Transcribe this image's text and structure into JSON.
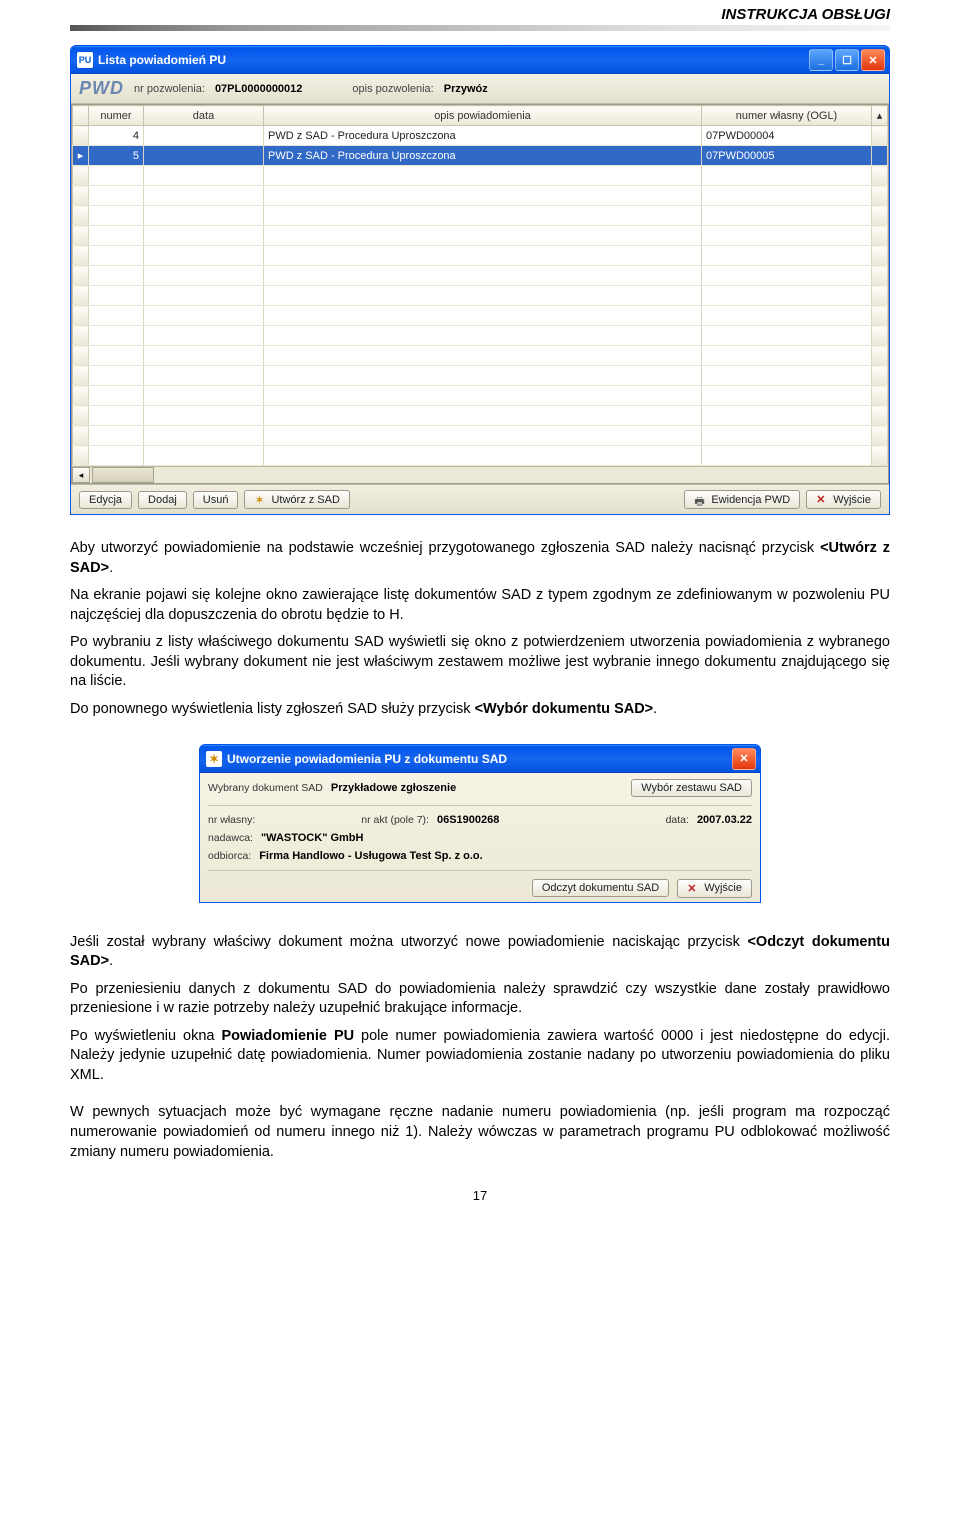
{
  "header": {
    "title": "INSTRUKCJA OBSŁUGI"
  },
  "window1": {
    "icon_label": "PU",
    "title": "Lista powiadomień PU",
    "pwd_label": "PWD",
    "nr_label": "nr pozwolenia:",
    "nr_value": "07PL0000000012",
    "opis_label": "opis pozwolenia:",
    "opis_value": "Przywóz",
    "cols": {
      "numer": "numer",
      "data": "data",
      "opis": "opis powiadomienia",
      "wlasny": "numer własny (OGL)"
    },
    "rows": [
      {
        "numer": "4",
        "data": "",
        "opis": "PWD z SAD - Procedura Uproszczona",
        "wlasny": "07PWD00004",
        "selected": false
      },
      {
        "numer": "5",
        "data": "",
        "opis": "PWD z SAD - Procedura Uproszczona",
        "wlasny": "07PWD00005",
        "selected": true
      }
    ],
    "buttons": {
      "edycja": "Edycja",
      "dodaj": "Dodaj",
      "usun": "Usuń",
      "utworz": "Utwórz z SAD",
      "ewid": "Ewidencja PWD",
      "wyjscie": "Wyjście"
    }
  },
  "para1_a": "Aby utworzyć powiadomienie na podstawie wcześniej przygotowanego zgłoszenia SAD należy nacisnąć przycisk ",
  "para1_b": "<Utwórz z SAD>",
  "para1_c": ".",
  "para2": "Na ekranie pojawi się kolejne okno zawierające listę dokumentów SAD z typem zgodnym ze zdefiniowanym w pozwoleniu PU najczęściej dla dopuszczenia do obrotu będzie to H.",
  "para3": "Po wybraniu z listy właściwego dokumentu SAD wyświetli się okno z potwierdzeniem utworzenia powiadomienia z wybranego dokumentu. Jeśli wybrany dokument nie jest właściwym zestawem możliwe jest wybranie innego dokumentu znajdującego się na liście.",
  "para4_a": "Do ponownego wyświetlenia listy zgłoszeń SAD służy przycisk ",
  "para4_b": "<Wybór dokumentu SAD>",
  "para4_c": ".",
  "window2": {
    "title": "Utworzenie powiadomienia PU z dokumentu SAD",
    "wybrany_lbl": "Wybrany dokument SAD",
    "wybrany_val": "Przykładowe zgłoszenie",
    "btn_wybor": "Wybór zestawu SAD",
    "nr_wlasny_lbl": "nr własny:",
    "nr_akt_lbl": "nr akt (pole 7):",
    "nr_akt_val": "06S1900268",
    "data_lbl": "data:",
    "data_val": "2007.03.22",
    "nadawca_lbl": "nadawca:",
    "nadawca_val": "\"WASTOCK\" GmbH",
    "odbiorca_lbl": "odbiorca:",
    "odbiorca_val": "Firma Handlowo - Usługowa Test Sp. z o.o.",
    "btn_odczyt": "Odczyt dokumentu SAD",
    "btn_wyjscie": "Wyjście"
  },
  "para5_a": "Jeśli został wybrany  właściwy dokument można utworzyć nowe powiadomienie naciskając przycisk ",
  "para5_b": "<Odczyt dokumentu SAD>",
  "para5_c": ".",
  "para6": "Po  przeniesieniu danych z dokumentu SAD do powiadomienia należy sprawdzić czy wszystkie dane zostały prawidłowo przeniesione i w razie potrzeby należy uzupełnić brakujące informacje.",
  "para7_a": "Po wyświetleniu okna ",
  "para7_b": "Powiadomienie PU",
  "para7_c": " pole numer powiadomienia zawiera wartość 0000 i jest niedostępne do edycji. Należy jedynie uzupełnić datę powiadomienia. Numer powiadomienia zostanie nadany po utworzeniu powiadomienia do pliku XML.",
  "para8": "W pewnych sytuacjach może być wymagane ręczne nadanie numeru powiadomienia (np. jeśli program ma rozpocząć numerowanie powiadomień od numeru innego niż 1). Należy wówczas w parametrach programu PU odblokować możliwość zmiany numeru powiadomienia.",
  "page_number": "17"
}
